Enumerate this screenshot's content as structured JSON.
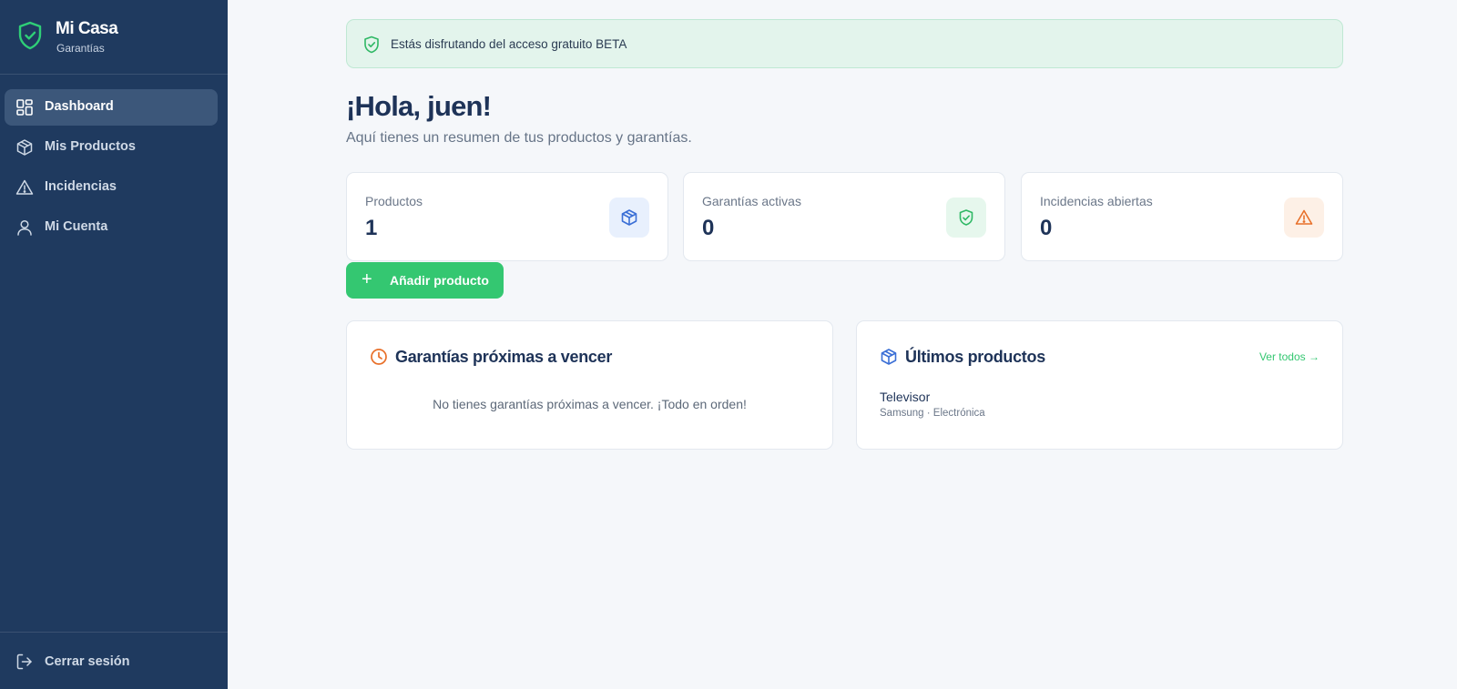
{
  "brand": {
    "name": "Mi Casa",
    "subtitle": "Garantías"
  },
  "nav": {
    "items": [
      {
        "label": "Dashboard",
        "icon": "dashboard-grid-icon",
        "active": true
      },
      {
        "label": "Mis Productos",
        "icon": "box-icon",
        "active": false
      },
      {
        "label": "Incidencias",
        "icon": "warning-triangle-icon",
        "active": false
      },
      {
        "label": "Mi Cuenta",
        "icon": "user-icon",
        "active": false
      }
    ],
    "logout_label": "Cerrar sesión"
  },
  "banner": {
    "text": "Estás disfrutando del acceso gratuito BETA",
    "icon": "shield-check-icon"
  },
  "header": {
    "greeting": "¡Hola, juen!",
    "subtitle": "Aquí tienes un resumen de tus productos y garantías."
  },
  "stats": [
    {
      "label": "Productos",
      "value": "1",
      "icon": "box-icon",
      "color": "#3b6fd6"
    },
    {
      "label": "Garantías activas",
      "value": "0",
      "icon": "shield-check-icon",
      "color": "#2fb865"
    },
    {
      "label": "Incidencias abiertas",
      "value": "0",
      "icon": "warning-triangle-icon",
      "color": "#e8702a"
    }
  ],
  "actions": {
    "add_product_label": "Añadir producto"
  },
  "expiring": {
    "title": "Garantías próximas a vencer",
    "empty_text": "No tienes garantías próximas a vencer. ¡Todo en orden!",
    "icon": "clock-icon"
  },
  "latest": {
    "title": "Últimos productos",
    "link_label": "Ver todos →",
    "icon": "box-icon",
    "products": [
      {
        "name": "Televisor",
        "meta": "Samsung · Electrónica"
      }
    ]
  },
  "colors": {
    "sidebar": "#1f3a5f",
    "accent": "#34c771",
    "text": "#1e3358",
    "warning": "#e8702a",
    "info": "#3b6fd6"
  }
}
